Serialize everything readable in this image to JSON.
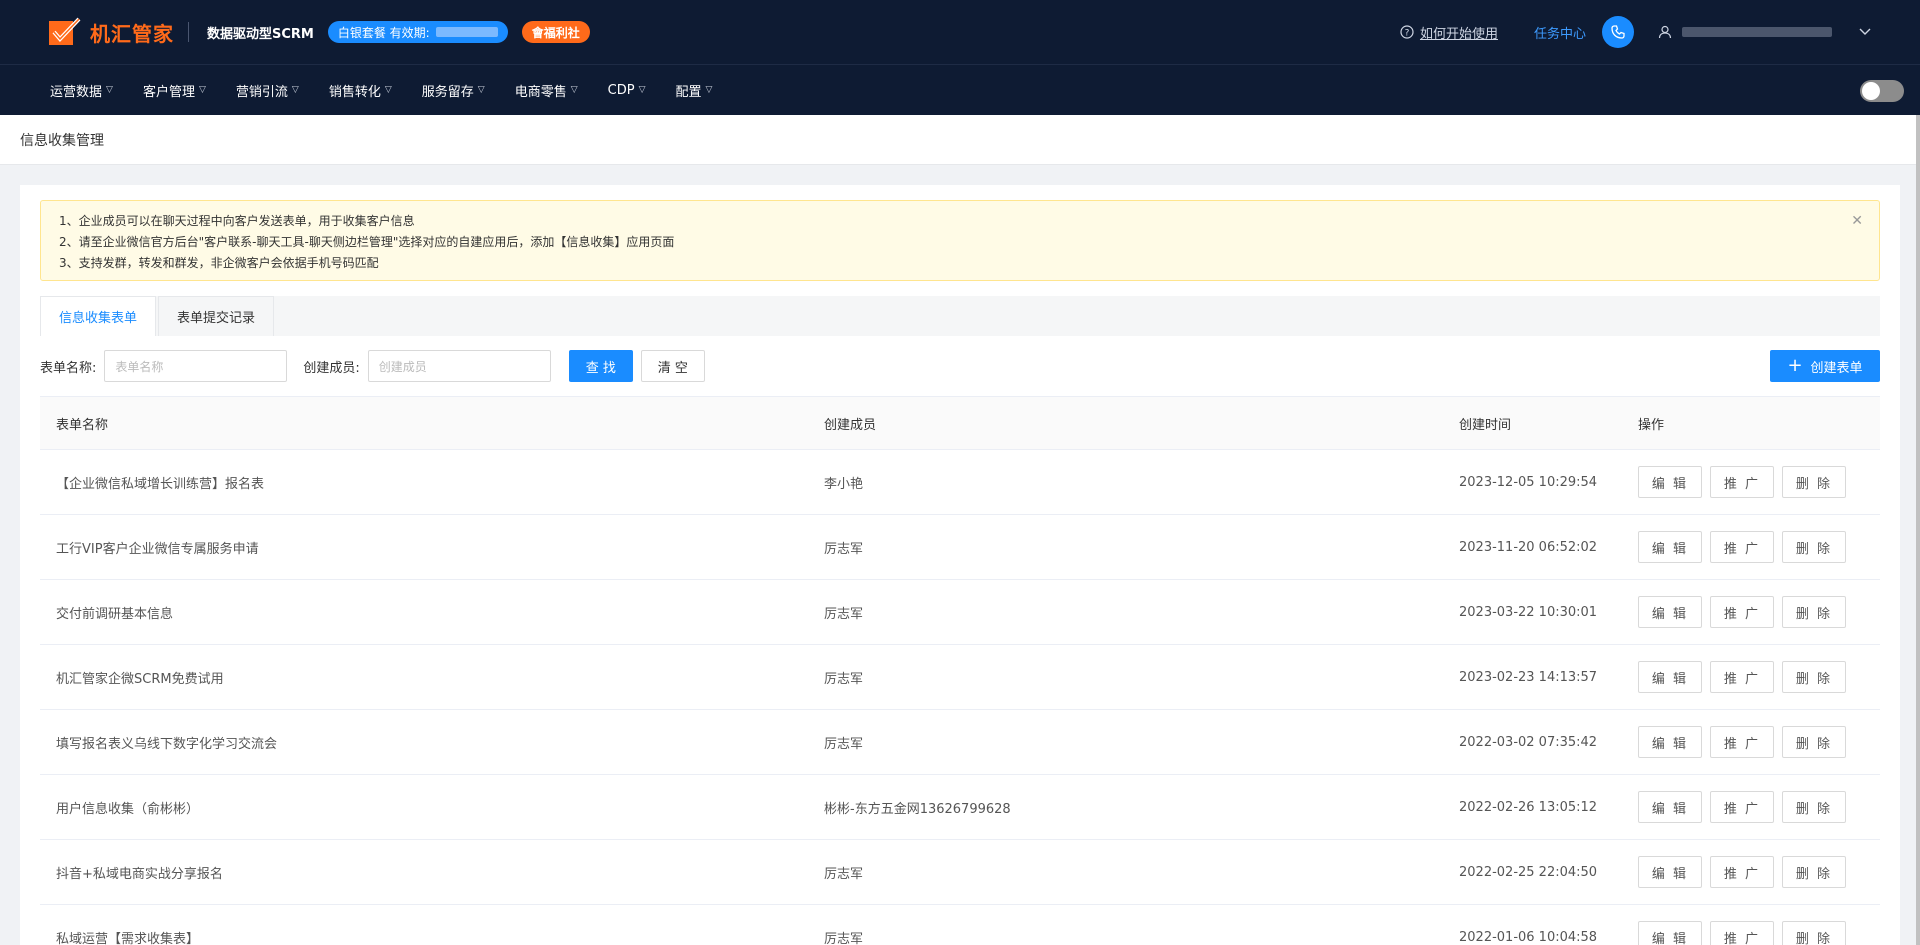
{
  "header": {
    "logo_text": "机汇管家",
    "logo_sub": "数据驱动型SCRM",
    "package_label": "白银套餐 有效期:",
    "welfare_label": "會福利社",
    "help_label": "如何开始使用",
    "task_center_label": "任务中心"
  },
  "nav": {
    "items": [
      {
        "label": "运营数据"
      },
      {
        "label": "客户管理"
      },
      {
        "label": "营销引流"
      },
      {
        "label": "销售转化"
      },
      {
        "label": "服务留存"
      },
      {
        "label": "电商零售"
      },
      {
        "label": "CDP"
      },
      {
        "label": "配置"
      }
    ]
  },
  "page": {
    "title": "信息收集管理"
  },
  "alert": {
    "lines": [
      "1、企业成员可以在聊天过程中向客户发送表单，用于收集客户信息",
      "2、请至企业微信官方后台\"客户联系-聊天工具-聊天侧边栏管理\"选择对应的自建应用后，添加【信息收集】应用页面",
      "3、支持发群，转发和群发，非企微客户会依据手机号码匹配"
    ]
  },
  "tabs": [
    {
      "label": "信息收集表单",
      "active": true
    },
    {
      "label": "表单提交记录",
      "active": false
    }
  ],
  "filters": {
    "name_label": "表单名称:",
    "name_placeholder": "表单名称",
    "creator_label": "创建成员:",
    "creator_placeholder": "创建成员",
    "search_label": "查 找",
    "clear_label": "清 空",
    "create_label": "创建表单"
  },
  "table": {
    "columns": [
      "表单名称",
      "创建成员",
      "创建时间",
      "操作"
    ],
    "actions": {
      "edit": "编 辑",
      "promote": "推 广",
      "delete": "删 除"
    },
    "rows": [
      {
        "name": "【企业微信私域增长训练营】报名表",
        "creator": "李小艳",
        "time": "2023-12-05 10:29:54"
      },
      {
        "name": "工行VIP客户企业微信专属服务申请",
        "creator": "厉志军",
        "time": "2023-11-20 06:52:02"
      },
      {
        "name": "交付前调研基本信息",
        "creator": "厉志军",
        "time": "2023-03-22 10:30:01"
      },
      {
        "name": "机汇管家企微SCRM免费试用",
        "creator": "厉志军",
        "time": "2023-02-23 14:13:57"
      },
      {
        "name": "填写报名表义乌线下数字化学习交流会",
        "creator": "厉志军",
        "time": "2022-03-02 07:35:42"
      },
      {
        "name": "用户信息收集（俞彬彬）",
        "creator": "彬彬-东方五金网13626799628",
        "time": "2022-02-26 13:05:12"
      },
      {
        "name": "抖音+私域电商实战分享报名",
        "creator": "厉志军",
        "time": "2022-02-25 22:04:50"
      },
      {
        "name": "私域运营【需求收集表】",
        "creator": "厉志军",
        "time": "2022-01-06 10:04:58"
      }
    ]
  },
  "colors": {
    "header_bg": "#0e1b33",
    "brand_orange": "#ff6a1a",
    "primary_blue": "#1a8cff"
  }
}
